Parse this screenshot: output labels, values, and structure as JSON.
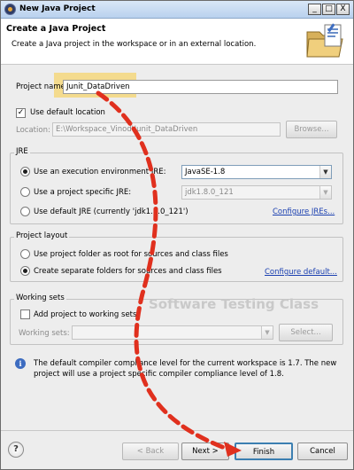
{
  "window": {
    "title": "New Java Project",
    "controls": {
      "minimize": "_",
      "maximize": "□",
      "close": "X"
    }
  },
  "header": {
    "title": "Create a Java Project",
    "description": "Create a Java project in the workspace or in an external location."
  },
  "project": {
    "name_label": "Project name:",
    "name_value": "Junit_DataDriven",
    "use_default_location_label": "Use default location",
    "use_default_location_checked": true,
    "location_label": "Location:",
    "location_value": "E:\\Workspace_Vinod\\Junit_DataDriven",
    "browse_label": "Browse..."
  },
  "jre": {
    "group_title": "JRE",
    "options": [
      {
        "label": "Use an execution environment JRE:",
        "selected": true
      },
      {
        "label": "Use a project specific JRE:",
        "selected": false
      },
      {
        "label": "Use default JRE (currently 'jdk1.8.0_121')",
        "selected": false
      }
    ],
    "execution_env_value": "JavaSE-1.8",
    "project_jre_value": "jdk1.8.0_121",
    "configure_link": "Configure JREs..."
  },
  "layout": {
    "group_title": "Project layout",
    "options": [
      {
        "label": "Use project folder as root for sources and class files",
        "selected": false
      },
      {
        "label": "Create separate folders for sources and class files",
        "selected": true
      }
    ],
    "configure_link": "Configure default..."
  },
  "working_sets": {
    "group_title": "Working sets",
    "add_label": "Add project to working sets",
    "add_checked": false,
    "sets_label": "Working sets:",
    "sets_value": "",
    "select_label": "Select..."
  },
  "watermark": "Software Testing Class",
  "info": {
    "text": "The default compiler compliance level for the current workspace is 1.7. The new project will use a project specific compiler compliance level of 1.8."
  },
  "footer": {
    "help": "?",
    "back": "< Back",
    "next": "Next >",
    "finish": "Finish",
    "cancel": "Cancel"
  },
  "colors": {
    "highlight": "#f4d77d",
    "arrow": "#e0301e",
    "link": "#1a3fb0"
  }
}
